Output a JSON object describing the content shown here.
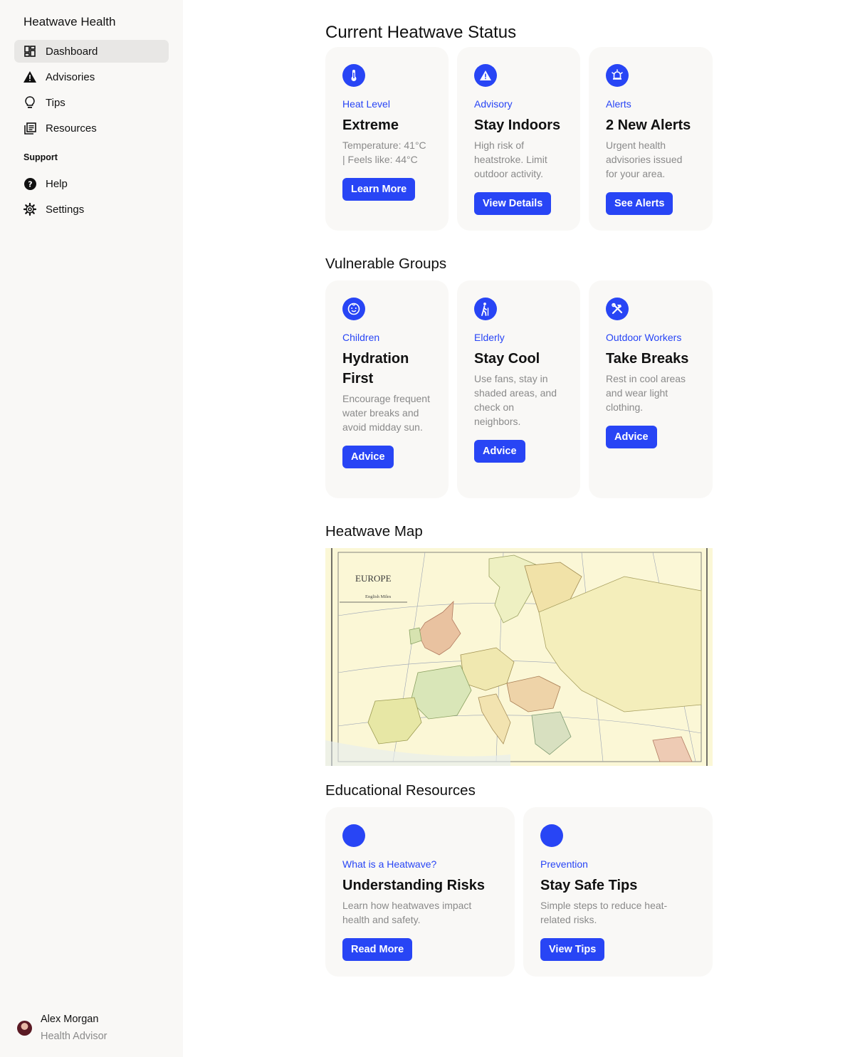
{
  "sidebar": {
    "app_title": "Heatwave Health",
    "nav_items": [
      {
        "label": "Dashboard",
        "icon": "dashboard-icon",
        "active": true
      },
      {
        "label": "Advisories",
        "icon": "warning-icon"
      },
      {
        "label": "Tips",
        "icon": "lightbulb-icon"
      },
      {
        "label": "Resources",
        "icon": "document-icon"
      }
    ],
    "support_label": "Support",
    "support_items": [
      {
        "label": "Help",
        "icon": "help-icon"
      },
      {
        "label": "Settings",
        "icon": "gear-icon"
      }
    ],
    "user": {
      "name": "Alex Morgan",
      "role": "Health Advisor"
    }
  },
  "status": {
    "heading": "Current Heatwave Status",
    "cards": [
      {
        "category": "Heat Level",
        "title": "Extreme",
        "desc": "Temperature: 41°C | Feels like: 44°C",
        "button": "Learn More",
        "icon": "thermometer-icon"
      },
      {
        "category": "Advisory",
        "title": "Stay Indoors",
        "desc": "High risk of heatstroke. Limit outdoor activity.",
        "button": "View Details",
        "icon": "warning-icon"
      },
      {
        "category": "Alerts",
        "title": "2 New Alerts",
        "desc": "Urgent health advisories issued for your area.",
        "button": "See Alerts",
        "icon": "alarm-bell-icon"
      }
    ]
  },
  "vulnerable": {
    "heading": "Vulnerable Groups",
    "cards": [
      {
        "category": "Children",
        "title": "Hydration First",
        "desc": "Encourage frequent water breaks and avoid midday sun.",
        "button": "Advice",
        "icon": "child-face-icon"
      },
      {
        "category": "Elderly",
        "title": "Stay Cool",
        "desc": "Use fans, stay in shaded areas, and check on neighbors.",
        "button": "Advice",
        "icon": "elderly-walking-icon"
      },
      {
        "category": "Outdoor Workers",
        "title": "Take Breaks",
        "desc": "Rest in cool areas and wear light clothing.",
        "button": "Advice",
        "icon": "tools-icon"
      }
    ]
  },
  "map": {
    "heading": "Heatwave Map",
    "map_title": "EUROPE",
    "scale_label": "English Miles"
  },
  "education": {
    "heading": "Educational Resources",
    "cards": [
      {
        "category": "What is a Heatwave?",
        "title": "Understanding Risks",
        "desc": "Learn how heatwaves impact health and safety.",
        "button": "Read More"
      },
      {
        "category": "Prevention",
        "title": "Stay Safe Tips",
        "desc": "Simple steps to reduce heat-related risks.",
        "button": "View Tips"
      }
    ]
  },
  "colors": {
    "accent": "#2845f5",
    "sidebar_bg": "#f9f8f6",
    "card_bg": "#f9f8f6"
  }
}
